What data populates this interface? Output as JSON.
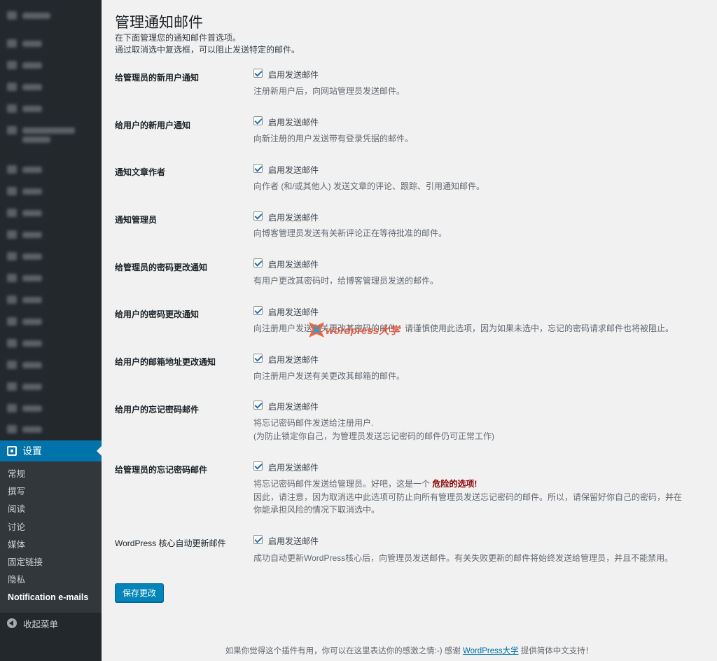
{
  "sidebar": {
    "settings_label": "设置",
    "submenu": [
      "常规",
      "撰写",
      "阅读",
      "讨论",
      "媒体",
      "固定链接",
      "隐私",
      "Notification e-mails"
    ],
    "collapse_label": "收起菜单"
  },
  "page": {
    "title": "管理通知邮件",
    "intro_line1": "在下面管理您的通知邮件首选项。",
    "intro_line2": "通过取消选中复选框，可以阻止发送特定的邮件。"
  },
  "checkbox_label": "启用发送邮件",
  "rows": [
    {
      "label": "给管理员的新用户通知",
      "checked": true,
      "desc": [
        "注册新用户后，向网站管理员发送邮件。"
      ]
    },
    {
      "label": "给用户的新用户通知",
      "checked": true,
      "desc": [
        "向新注册的用户发送带有登录凭据的邮件。"
      ]
    },
    {
      "label": "通知文章作者",
      "checked": true,
      "desc": [
        "向作者 (和/或其他人) 发送文章的评论、跟踪、引用通知邮件。"
      ]
    },
    {
      "label": "通知管理员",
      "checked": true,
      "desc": [
        "向博客管理员发送有关新评论正在等待批准的邮件。"
      ]
    },
    {
      "label": "给管理员的密码更改通知",
      "checked": true,
      "desc": [
        "有用户更改其密码时，给博客管理员发送的邮件。"
      ]
    },
    {
      "label": "给用户的密码更改通知",
      "checked": true,
      "desc": [
        "向注册用户发送有关更改其密码的邮件。请谨慎使用此选项，因为如果未选中，忘记的密码请求邮件也将被阻止。"
      ]
    },
    {
      "label": "给用户的邮箱地址更改通知",
      "checked": true,
      "desc": [
        "向注册用户发送有关更改其邮箱的邮件。"
      ]
    },
    {
      "label": "给用户的忘记密码邮件",
      "checked": true,
      "desc": [
        "将忘记密码邮件发送给注册用户.",
        "(为防止锁定你自己，为管理员发送忘记密码的邮件仍可正常工作)"
      ]
    },
    {
      "label": "给管理员的忘记密码邮件",
      "checked": true,
      "desc_pre": "将忘记密码邮件发送给管理员。好吧，这是一个 ",
      "desc_danger": "危险的选项!",
      "desc": [
        "因此，请注意，因为取消选中此选项可防止向所有管理员发送忘记密码的邮件。所以，请保留好你自己的密码，并在",
        "你能承担风险的情况下取消选中。"
      ]
    },
    {
      "label": "WordPress 核心自动更新邮件",
      "checked": true,
      "desc": [
        "成功自动更新WordPress核心后，向管理员发送邮件。有关失败更新的邮件将始终发送给管理员，并且不能禁用。"
      ]
    }
  ],
  "save_label": "保存更改",
  "footer": {
    "text_pre": "如果你觉得这个插件有用，你可以在这里表达你的感激之情:-) 感谢 ",
    "link": "WordPress大学",
    "text_post": " 提供简体中文支持！"
  },
  "watermark": "wordpress大学",
  "colors": {
    "sidebar_bg": "#23282d",
    "submenu_bg": "#32373c",
    "accent": "#0073aa",
    "danger": "#8a0000"
  }
}
